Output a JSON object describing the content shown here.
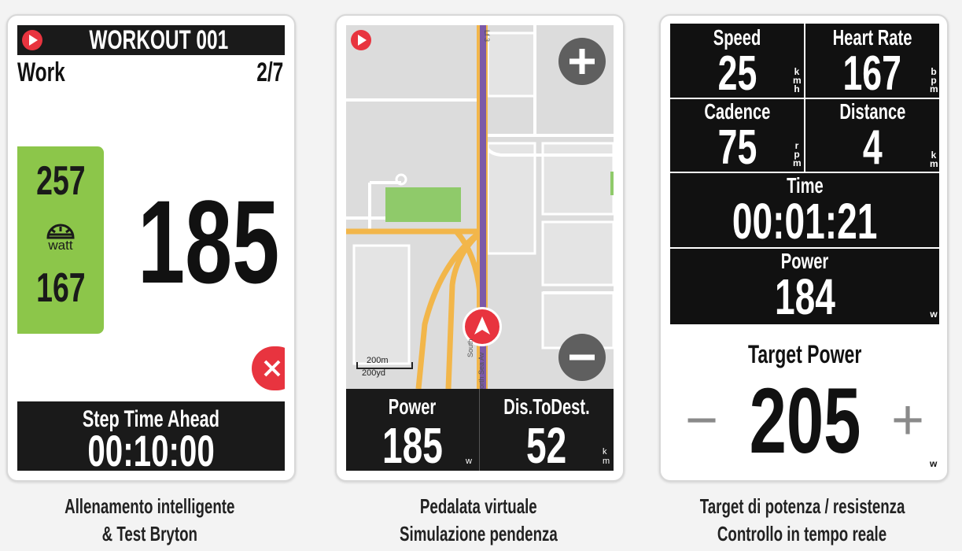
{
  "device1": {
    "header_title": "WORKOUT 001",
    "step_label": "Work",
    "step_count": "2/7",
    "zone_upper": "257",
    "zone_unit": "watt",
    "zone_lower": "167",
    "main_value": "185",
    "footer_label": "Step Time Ahead",
    "footer_value": "00:10:00"
  },
  "device2": {
    "scale_top": "200m",
    "scale_bottom": "200yd",
    "street_label": "Lf 3",
    "road_label_1": "South",
    "road_label_2": "orth Sea Av",
    "power_label": "Power",
    "power_value": "185",
    "power_unit": "w",
    "dist_label": "Dis.ToDest.",
    "dist_value": "52",
    "dist_unit": "km"
  },
  "device3": {
    "speed_label": "Speed",
    "speed_value": "25",
    "speed_unit": "kmh",
    "hr_label": "Heart Rate",
    "hr_value": "167",
    "hr_unit": "bpm",
    "cadence_label": "Cadence",
    "cadence_value": "75",
    "cadence_unit": "rpm",
    "distance_label": "Distance",
    "distance_value": "4",
    "distance_unit": "km",
    "time_label": "Time",
    "time_value": "00:01:21",
    "power_label": "Power",
    "power_value": "184",
    "power_unit": "w",
    "target_label": "Target Power",
    "target_value": "205",
    "target_unit": "w",
    "minus": "−",
    "plus": "+"
  },
  "captions": {
    "c1_line1": "Allenamento intelligente",
    "c1_line2": "& Test Bryton",
    "c2_line1": "Pedalata virtuale",
    "c2_line2": "Simulazione pendenza",
    "c3_line1": "Target di potenza / resistenza",
    "c3_line2": "Controllo in tempo reale"
  },
  "colors": {
    "accent_red": "#e8343f",
    "zone_green": "#8cc64a",
    "park_green": "#8fca6a",
    "road_orange": "#f2b64a",
    "route_purple": "#7c5aa8"
  }
}
